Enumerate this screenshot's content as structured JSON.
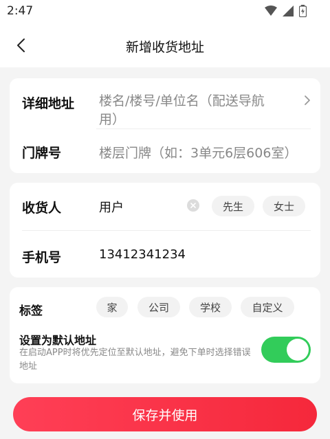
{
  "status_bar": {
    "time": "2:47"
  },
  "header": {
    "title": "新增收货地址"
  },
  "address_card": {
    "detail_label": "详细地址",
    "detail_placeholder_line1": "楼名/楼号/单位名（配送导航",
    "detail_placeholder_line2": "用）",
    "door_label": "门牌号",
    "door_placeholder": "楼层门牌（如：3单元6层606室）"
  },
  "contact_card": {
    "receiver_label": "收货人",
    "receiver_value": "用户",
    "gender_options": [
      "先生",
      "女士"
    ],
    "phone_label": "手机号",
    "phone_value": "13412341234"
  },
  "settings_card": {
    "tag_label": "标签",
    "tags": [
      "家",
      "公司",
      "学校",
      "自定义"
    ],
    "default_title": "设置为默认地址",
    "default_desc": "在启动APP时将优先定位至默认地址，避免下单时选择错误地址",
    "default_enabled": true,
    "toggle_color": "#32cc5a"
  },
  "footer": {
    "save_label": "保存并使用",
    "accent_color": "#f5283b"
  }
}
